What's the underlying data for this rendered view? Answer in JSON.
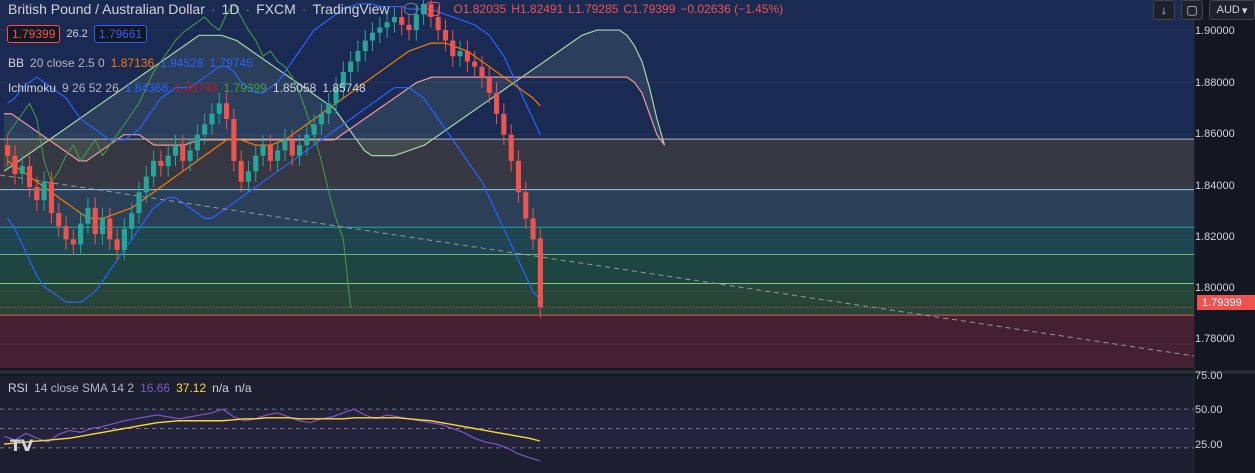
{
  "header": {
    "symbol": "British Pound / Australian Dollar",
    "interval": "1D",
    "exchange": "FXCM",
    "source": "TradingView",
    "ohlc": {
      "o": "O1.82035",
      "h": "H1.82491",
      "l": "L1.79285",
      "c": "C1.79399",
      "chg": "−0.02636 (−1.45%)"
    },
    "currency": "AUD"
  },
  "trade": {
    "sell": "1.79399",
    "spread": "26.2",
    "buy": "1.79661"
  },
  "indicators": {
    "bb": {
      "label": "BB",
      "params": "20 close 2.5 0",
      "v1": "1.87136",
      "v2": "1.94528",
      "v3": "1.79745"
    },
    "ichimoku": {
      "label": "Ichimoku",
      "params": "9 26 52 26",
      "v1": "1.84368",
      "v2": "1.88748",
      "v3": "1.79399",
      "v4": "1.85058",
      "v5": "1.85748"
    },
    "rsi": {
      "label": "RSI",
      "params": "14 close SMA 14 2",
      "v1": "16.66",
      "v2": "37.12",
      "v3": "n/a",
      "v4": "n/a"
    }
  },
  "colors": {
    "bb_basis": "#f57c00",
    "bb_band": "#2962ff",
    "tenkan": "#2962ff",
    "kijun": "#b71c1c",
    "lagging": "#43a047",
    "leadA": "#a5d6a7",
    "leadB": "#ef9a9a",
    "up": "#26a69a",
    "down": "#ef5350",
    "rsi": "#7e57c2",
    "rsi_ma": "#fdd835"
  },
  "axis": {
    "price_ticks": [
      "1.90000",
      "1.88000",
      "1.86000",
      "1.84000",
      "1.82000",
      "1.80000",
      "1.78000"
    ],
    "current_price": "1.79399",
    "rsi_ticks": [
      "75.00",
      "50.00",
      "25.00"
    ]
  },
  "chart_data": {
    "type": "candlestick",
    "title": "British Pound / Australian Dollar",
    "ylim": [
      1.7708,
      1.9115
    ],
    "levels": [
      1.8583,
      1.839,
      1.8246,
      1.8142,
      1.8031,
      1.791
    ],
    "trendline": [
      [
        0,
        1.8446
      ],
      [
        100,
        1.7754
      ]
    ],
    "closes": [
      1.852,
      1.845,
      1.848,
      1.84,
      1.835,
      1.842,
      1.83,
      1.825,
      1.82,
      1.818,
      1.826,
      1.832,
      1.822,
      1.828,
      1.82,
      1.816,
      1.824,
      1.83,
      1.838,
      1.844,
      1.85,
      1.848,
      1.852,
      1.856,
      1.85,
      1.854,
      1.86,
      1.864,
      1.868,
      1.872,
      1.866,
      1.85,
      1.842,
      1.846,
      1.852,
      1.856,
      1.85,
      1.854,
      1.858,
      1.852,
      1.856,
      1.86,
      1.864,
      1.868,
      1.872,
      1.878,
      1.884,
      1.888,
      1.892,
      1.896,
      1.899,
      1.901,
      1.903,
      1.905,
      1.902,
      1.9,
      1.906,
      1.91,
      1.905,
      1.9,
      1.896,
      1.89,
      1.892,
      1.888,
      1.886,
      1.882,
      1.876,
      1.868,
      1.86,
      1.85,
      1.838,
      1.828,
      1.82,
      1.79399
    ],
    "opens": [
      1.856,
      1.852,
      1.845,
      1.848,
      1.84,
      1.835,
      1.842,
      1.83,
      1.825,
      1.82,
      1.818,
      1.826,
      1.832,
      1.822,
      1.828,
      1.82,
      1.816,
      1.824,
      1.83,
      1.838,
      1.844,
      1.85,
      1.848,
      1.852,
      1.856,
      1.85,
      1.854,
      1.86,
      1.864,
      1.868,
      1.872,
      1.866,
      1.85,
      1.842,
      1.846,
      1.852,
      1.856,
      1.85,
      1.854,
      1.858,
      1.852,
      1.856,
      1.86,
      1.864,
      1.868,
      1.872,
      1.878,
      1.884,
      1.888,
      1.892,
      1.896,
      1.899,
      1.901,
      1.903,
      1.905,
      1.902,
      1.9,
      1.906,
      1.91,
      1.905,
      1.9,
      1.896,
      1.89,
      1.892,
      1.888,
      1.886,
      1.882,
      1.876,
      1.868,
      1.86,
      1.85,
      1.838,
      1.828,
      1.82035
    ],
    "bb_upper": [
      1.872,
      1.874,
      1.878,
      1.88,
      1.882,
      1.88,
      1.878,
      1.876,
      1.874,
      1.87,
      1.866,
      1.864,
      1.862,
      1.86,
      1.858,
      1.858,
      1.858,
      1.86,
      1.862,
      1.866,
      1.87,
      1.874,
      1.876,
      1.878,
      1.878,
      1.878,
      1.88,
      1.882,
      1.884,
      1.886,
      1.886,
      1.884,
      1.88,
      1.878,
      1.876,
      1.876,
      1.878,
      1.88,
      1.884,
      1.888,
      1.892,
      1.896,
      1.9,
      1.902,
      1.904,
      1.906,
      1.908,
      1.909,
      1.91,
      1.91,
      1.91,
      1.909,
      1.909,
      1.909,
      1.909,
      1.908,
      1.908,
      1.908,
      1.908,
      1.907,
      1.906,
      1.905,
      1.904,
      1.903,
      1.902,
      1.9,
      1.898,
      1.894,
      1.89,
      1.884,
      1.878,
      1.872,
      1.866,
      1.86
    ],
    "bb_basis": [
      1.85,
      1.848,
      1.846,
      1.844,
      1.842,
      1.84,
      1.838,
      1.836,
      1.834,
      1.832,
      1.83,
      1.828,
      1.828,
      1.828,
      1.829,
      1.83,
      1.831,
      1.832,
      1.834,
      1.836,
      1.838,
      1.84,
      1.842,
      1.844,
      1.846,
      1.848,
      1.85,
      1.852,
      1.854,
      1.856,
      1.858,
      1.858,
      1.858,
      1.857,
      1.856,
      1.856,
      1.856,
      1.857,
      1.858,
      1.86,
      1.862,
      1.864,
      1.866,
      1.868,
      1.87,
      1.872,
      1.874,
      1.876,
      1.878,
      1.88,
      1.882,
      1.884,
      1.886,
      1.888,
      1.89,
      1.892,
      1.893,
      1.894,
      1.895,
      1.895,
      1.895,
      1.894,
      1.893,
      1.892,
      1.89,
      1.888,
      1.886,
      1.884,
      1.882,
      1.88,
      1.878,
      1.876,
      1.874,
      1.871
    ],
    "bb_lower": [
      1.828,
      1.824,
      1.818,
      1.812,
      1.806,
      1.802,
      1.8,
      1.798,
      1.796,
      1.796,
      1.796,
      1.798,
      1.8,
      1.804,
      1.808,
      1.812,
      1.816,
      1.82,
      1.824,
      1.828,
      1.832,
      1.834,
      1.836,
      1.836,
      1.834,
      1.832,
      1.83,
      1.828,
      1.828,
      1.83,
      1.832,
      1.834,
      1.836,
      1.838,
      1.84,
      1.842,
      1.844,
      1.846,
      1.848,
      1.85,
      1.852,
      1.854,
      1.856,
      1.858,
      1.86,
      1.862,
      1.864,
      1.866,
      1.868,
      1.87,
      1.872,
      1.874,
      1.876,
      1.878,
      1.878,
      1.878,
      1.876,
      1.874,
      1.87,
      1.866,
      1.862,
      1.858,
      1.854,
      1.85,
      1.846,
      1.842,
      1.836,
      1.83,
      1.824,
      1.818,
      1.812,
      1.806,
      1.8,
      1.797
    ],
    "cloud_a": [
      1.846,
      1.848,
      1.85,
      1.852,
      1.854,
      1.856,
      1.858,
      1.86,
      1.862,
      1.864,
      1.866,
      1.868,
      1.87,
      1.872,
      1.874,
      1.876,
      1.878,
      1.88,
      1.882,
      1.884,
      1.886,
      1.888,
      1.89,
      1.892,
      1.894,
      1.896,
      1.898,
      1.898,
      1.898,
      1.898,
      1.897,
      1.896,
      1.894,
      1.892,
      1.89,
      1.888,
      1.886,
      1.884,
      1.882,
      1.88,
      1.878,
      1.876,
      1.874,
      1.872,
      1.87,
      1.866,
      1.862,
      1.858,
      1.854,
      1.852,
      1.852,
      1.852,
      1.852,
      1.853,
      1.854,
      1.855,
      1.856,
      1.858,
      1.86,
      1.862,
      1.864,
      1.866,
      1.868,
      1.87,
      1.872,
      1.874,
      1.876,
      1.878,
      1.88,
      1.882,
      1.884,
      1.886,
      1.888,
      1.89,
      1.892,
      1.894,
      1.896,
      1.898,
      1.899,
      1.9,
      1.9,
      1.9,
      1.9,
      1.898,
      1.894,
      1.888,
      1.878,
      1.866,
      1.856
    ],
    "cloud_b": [
      1.868,
      1.868,
      1.866,
      1.864,
      1.862,
      1.86,
      1.858,
      1.856,
      1.854,
      1.852,
      1.85,
      1.85,
      1.852,
      1.854,
      1.856,
      1.858,
      1.86,
      1.86,
      1.86,
      1.858,
      1.856,
      1.856,
      1.856,
      1.856,
      1.856,
      1.857,
      1.858,
      1.858,
      1.858,
      1.858,
      1.858,
      1.858,
      1.858,
      1.858,
      1.858,
      1.858,
      1.858,
      1.858,
      1.858,
      1.858,
      1.858,
      1.858,
      1.858,
      1.858,
      1.858,
      1.86,
      1.862,
      1.864,
      1.866,
      1.868,
      1.87,
      1.872,
      1.874,
      1.876,
      1.878,
      1.88,
      1.881,
      1.882,
      1.882,
      1.882,
      1.882,
      1.882,
      1.882,
      1.882,
      1.882,
      1.882,
      1.882,
      1.882,
      1.882,
      1.882,
      1.882,
      1.882,
      1.882,
      1.882,
      1.882,
      1.882,
      1.882,
      1.882,
      1.882,
      1.882,
      1.882,
      1.882,
      1.882,
      1.882,
      1.88,
      1.876,
      1.868,
      1.86,
      1.856
    ],
    "rsi": [
      42,
      38,
      45,
      40,
      36,
      44,
      48,
      46,
      50,
      52,
      55,
      58,
      60,
      62,
      64,
      62,
      60,
      62,
      64,
      66,
      70,
      62,
      58,
      60,
      64,
      66,
      62,
      58,
      56,
      60,
      62,
      66,
      70,
      64,
      60,
      64,
      62,
      60,
      58,
      56,
      54,
      50,
      46,
      40,
      36,
      34,
      30,
      24,
      20,
      16.66
    ],
    "rsi_ma": [
      34,
      35,
      36,
      37,
      38,
      39,
      40,
      42,
      44,
      46,
      48,
      50,
      52,
      54,
      56,
      57,
      58,
      58,
      58,
      58,
      58,
      59,
      60,
      60,
      61,
      61,
      61,
      60,
      60,
      60,
      60,
      60,
      61,
      61,
      61,
      61,
      61,
      60,
      59,
      58,
      56,
      54,
      52,
      50,
      48,
      46,
      44,
      42,
      40,
      37.12
    ],
    "rsi_ylim": [
      0,
      100
    ]
  }
}
